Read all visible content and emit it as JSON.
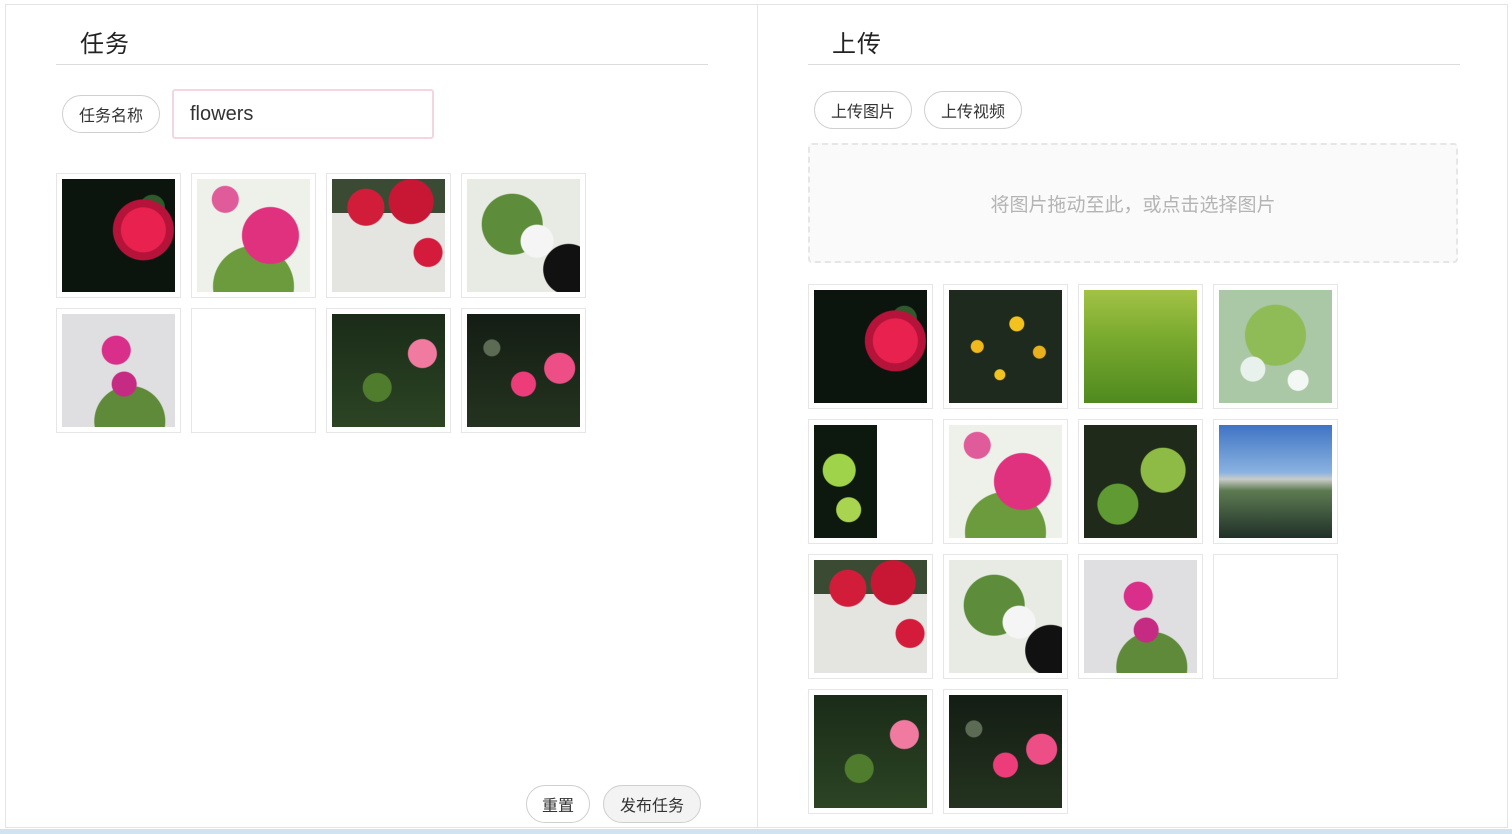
{
  "task_panel": {
    "title": "任务",
    "name_label": "任务名称",
    "name_value": "flowers",
    "images": [
      {
        "alt": "flower-1"
      },
      {
        "alt": "flower-2"
      },
      {
        "alt": "flower-3"
      },
      {
        "alt": "flower-4"
      },
      {
        "alt": "flower-5"
      },
      {
        "alt": "flower-6"
      },
      {
        "alt": "flower-7"
      },
      {
        "alt": "flower-8"
      }
    ],
    "reset_label": "重置",
    "publish_label": "发布任务"
  },
  "upload_panel": {
    "title": "上传",
    "upload_image_label": "上传图片",
    "upload_video_label": "上传视频",
    "dropzone_text": "将图片拖动至此，或点击选择图片",
    "images_count": 14
  },
  "colors": {
    "border": "#e4e4e4",
    "input_border": "#f3d6df",
    "dropzone_bg": "#fafafa",
    "bottom_bar": "#cfe3f1"
  }
}
